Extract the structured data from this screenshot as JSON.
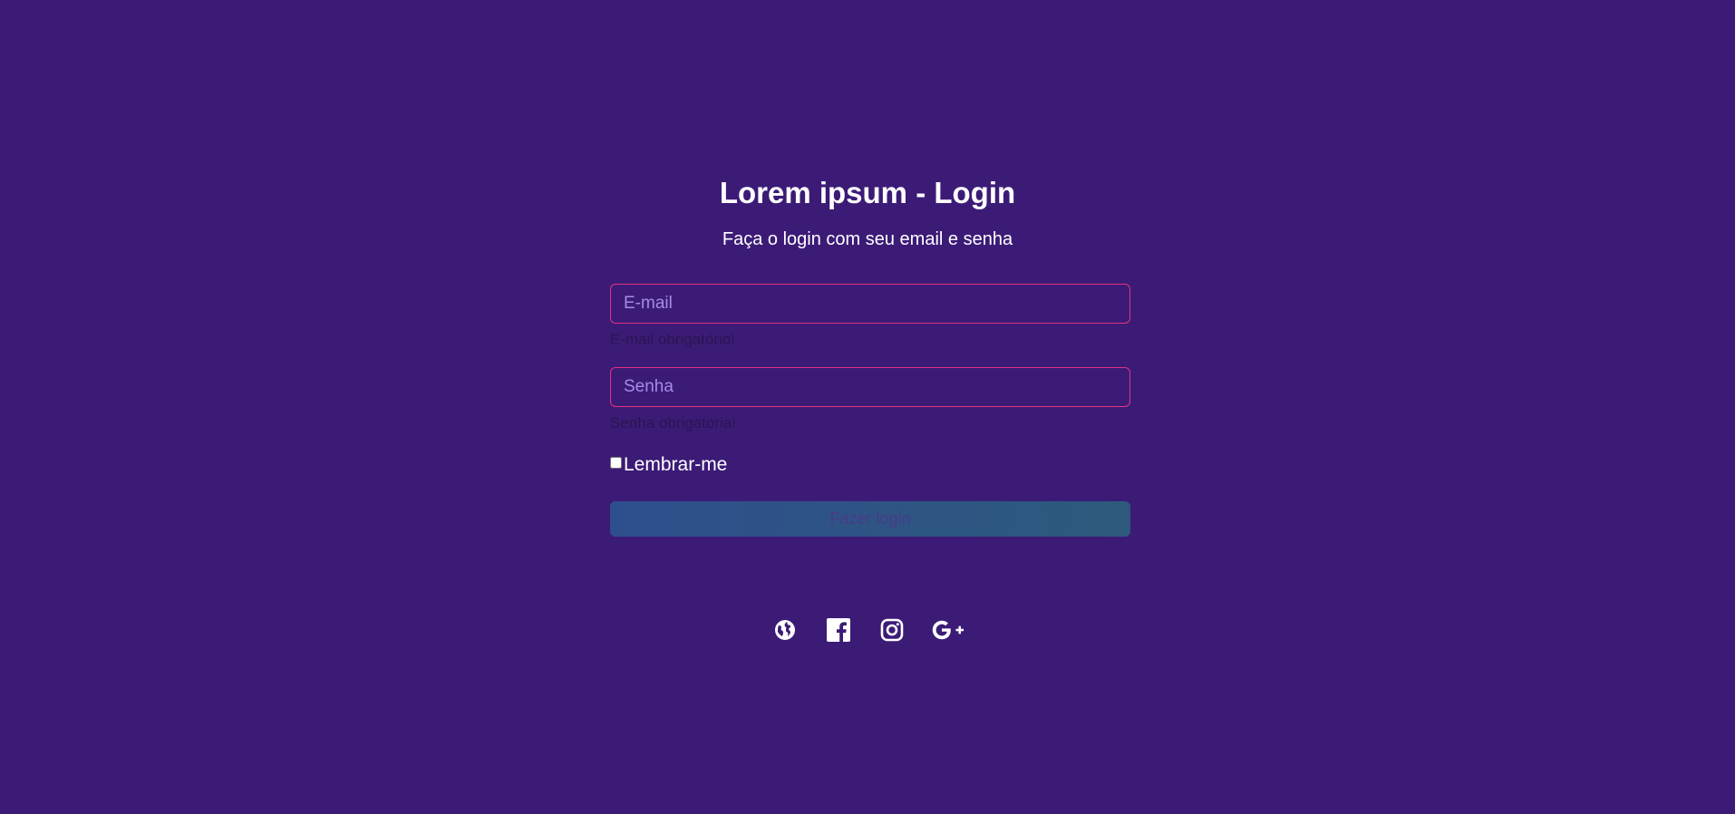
{
  "header": {
    "title": "Lorem ipsum - Login",
    "subtitle": "Faça o login com seu email e senha"
  },
  "form": {
    "email": {
      "placeholder": "E-mail",
      "value": "",
      "error": "E-mail obrigatório!"
    },
    "password": {
      "placeholder": "Senha",
      "value": "",
      "error": "Senha obrigatoria!"
    },
    "remember": {
      "label": "Lembrar-me",
      "checked": false
    },
    "submit_label": "Fazer login"
  },
  "social": [
    {
      "icon": "globe-icon"
    },
    {
      "icon": "facebook-icon"
    },
    {
      "icon": "instagram-icon"
    },
    {
      "icon": "google-plus-icon"
    }
  ],
  "colors": {
    "background": "#3c1b77",
    "input_border": "#e3327f",
    "placeholder": "#a48be6",
    "button": "#2e4f8d",
    "error_text": "#2a1650"
  }
}
